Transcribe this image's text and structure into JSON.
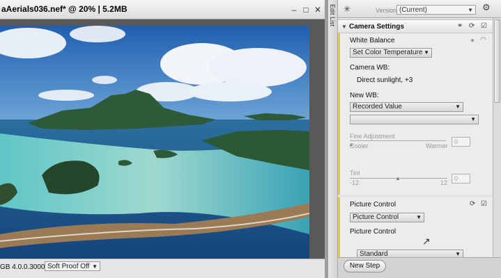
{
  "document": {
    "title": "aAerials036.nef* @ 20% | 5.2MB",
    "window_controls": [
      "–",
      "□",
      "✕"
    ],
    "status_profile": "GB 4.0.0.3000",
    "soft_proof": "Soft Proof Off"
  },
  "edit_tab": {
    "label": "Edit List"
  },
  "panel": {
    "version_label": "Version",
    "version_value": "(Current)",
    "camera_settings": {
      "title": "Camera Settings",
      "white_balance": {
        "label": "White Balance",
        "mode": "Set Color Temperature",
        "camera_wb_label": "Camera WB:",
        "camera_wb_value": "Direct sunlight, +3",
        "new_wb_label": "New WB:",
        "new_wb_value": "Recorded Value",
        "second_select_value": "",
        "fine_adjustment_label": "Fine Adjustment",
        "cooler_label": "Cooler",
        "warmer_label": "Warmer",
        "fine_value": "0",
        "tint_label": "Tint",
        "tint_min": "-12",
        "tint_max": "12",
        "tint_value": "0"
      }
    },
    "picture_control": {
      "label": "Picture Control",
      "select_value": "Picture Control",
      "sub_label": "Picture Control",
      "preset_value": "Standard"
    },
    "new_step": "New Step"
  }
}
